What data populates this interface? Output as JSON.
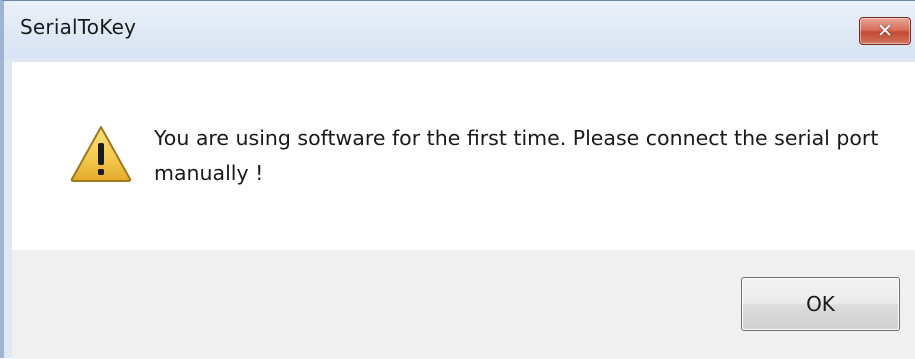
{
  "window": {
    "title": "SerialToKey",
    "close_symbol": "✕"
  },
  "dialog": {
    "icon": "warning-icon",
    "message": "You are using software for the first time. Please connect the serial port manually !",
    "ok_label": "OK"
  },
  "colors": {
    "titlebar": "#dfe9f5",
    "close_button": "#c44a34",
    "content_background": "#ffffff",
    "button_bar": "#f0f0f0",
    "warning_fill": "#f2c84b"
  }
}
